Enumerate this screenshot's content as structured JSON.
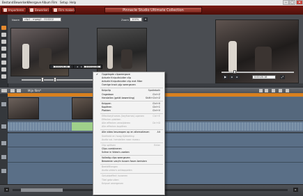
{
  "window": {
    "title": "Pinnacle Studio Ultimate Collection",
    "controls": [
      "–",
      "□",
      "✕"
    ]
  },
  "menubar": [
    "Bestand",
    "Bewerken",
    "Weergave",
    "Album",
    "Film",
    "Setup",
    "Help"
  ],
  "toolbar": {
    "buttons": [
      "Importeren",
      "Bewerken",
      "Film maken"
    ]
  },
  "preview": {
    "name_label": "Naam",
    "name_value": "clip1 - mpeg2 - 010202",
    "zoom_label": "Zoom",
    "zoom_value": "100%",
    "timecode_left": "0:00:20.16",
    "timecode_middle": "0:00:22.08",
    "timecode_right": "0:00:20.16"
  },
  "timeline": {
    "header_label": "Mijn film*"
  },
  "context_menu": {
    "items": [
      {
        "label": "Opgelegde clipweergave",
        "shortcut": "",
        "checked": true,
        "disabled": false
      },
      {
        "label": "Actuele Knipuitsluiter clip",
        "shortcut": "",
        "checked": false,
        "disabled": false
      },
      {
        "label": "Actuele Knipuitsluiter clip met filter",
        "shortcut": "",
        "checked": false,
        "disabled": false
      },
      {
        "label": "Overige track pijp weergeven",
        "shortcut": "",
        "checked": false,
        "disabled": false
      },
      {
        "sep": true
      },
      {
        "label": "Knipclip",
        "shortcut": "Spatiebalk",
        "checked": false,
        "disabled": false
      },
      {
        "label": "Ongedaan",
        "shortcut": "Ctrl+Z",
        "checked": false,
        "disabled": false
      },
      {
        "label": "Herstellen (geldt bewerking)",
        "shortcut": "Shift+Ctrl+Z",
        "checked": false,
        "disabled": false
      },
      {
        "sep": true
      },
      {
        "label": "Knippen",
        "shortcut": "Ctrl+X",
        "checked": false,
        "disabled": false
      },
      {
        "label": "Kopiëren",
        "shortcut": "Ctrl+C",
        "checked": false,
        "disabled": false
      },
      {
        "label": "Plakken",
        "shortcut": "Ctrl+V",
        "checked": false,
        "disabled": false
      },
      {
        "sep": true
      },
      {
        "label": "Effectkeyframes (keyframes) openen",
        "shortcut": "Ctrl+E",
        "checked": false,
        "disabled": true
      },
      {
        "label": "Effecten plakken",
        "shortcut": "",
        "checked": false,
        "disabled": true
      },
      {
        "label": "Alle effecten verwijderen",
        "shortcut": "Ctrl+D",
        "checked": false,
        "disabled": true
      },
      {
        "label": "Alle effecten kopiëren",
        "shortcut": "",
        "checked": false,
        "disabled": true
      },
      {
        "sep": true
      },
      {
        "label": "Alle video keuzeopen op en alternatieven",
        "shortcut": "Alt",
        "checked": false,
        "disabled": false
      },
      {
        "label": "Snelheid en hoog tijdmeting",
        "shortcut": "",
        "checked": false,
        "disabled": true
      },
      {
        "label": "Audio vol. herstellen naar niveau",
        "shortcut": "",
        "checked": false,
        "disabled": true
      },
      {
        "sep": true
      },
      {
        "label": "Clip splitsen",
        "shortcut": "Enter",
        "checked": false,
        "disabled": true
      },
      {
        "label": "Clips combineren",
        "shortcut": "",
        "checked": false,
        "disabled": false
      },
      {
        "label": "Scène in Video's zoeken",
        "shortcut": "",
        "checked": false,
        "disabled": false
      },
      {
        "sep": true
      },
      {
        "label": "Volledig clips weergeven",
        "shortcut": "",
        "checked": false,
        "disabled": false
      },
      {
        "label": "Beweeren van/in tussen fasen berisken",
        "shortcut": "",
        "checked": false,
        "disabled": false
      },
      {
        "sep": true
      },
      {
        "label": "Beeldfiltergen",
        "shortcut": "",
        "checked": false,
        "disabled": true
      },
      {
        "label": "Audio-video's ontkoppelen",
        "shortcut": "",
        "checked": false,
        "disabled": true
      },
      {
        "sep": true
      },
      {
        "label": "Geluidseffect invoeren",
        "shortcut": "",
        "checked": false,
        "disabled": true
      },
      {
        "label": "Titel gebruiken",
        "shortcut": "",
        "checked": false,
        "disabled": true
      },
      {
        "label": "Knipsel weergeven",
        "shortcut": "",
        "checked": false,
        "disabled": true
      }
    ]
  },
  "colors": {
    "toolbar_red": "#7a1b14",
    "ruler_orange": "#d9801e",
    "audio_green": "#9fd08a",
    "video_blue": "#6f8fb0"
  },
  "icons": {
    "left_strip": [
      "video-icon",
      "photo-icon",
      "title-icon",
      "menu-icon",
      "transition-icon",
      "sound-icon",
      "music-icon",
      "effect-icon"
    ]
  }
}
